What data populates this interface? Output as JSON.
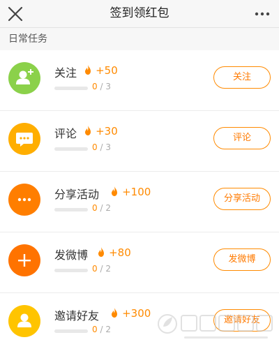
{
  "header": {
    "title": "签到领红包",
    "close_icon": "close-icon",
    "more_icon": "more-dots-icon"
  },
  "section": {
    "title": "日常任务"
  },
  "colors": {
    "accent": "#ff8a00",
    "follow_icon_bg": "#8bd14a",
    "comment_icon_bg": "#ffae00",
    "share_icon_bg": "#ff7e00",
    "post_icon_bg": "#ff7300",
    "invite_icon_bg": "#ffc400"
  },
  "tasks": [
    {
      "name": "关注",
      "reward": "+50",
      "progress_done": "0",
      "progress_total": "/ 3",
      "progress_fraction": 0,
      "button_label": "关注",
      "icon": "add-user-icon"
    },
    {
      "name": "评论",
      "reward": "+30",
      "progress_done": "0",
      "progress_total": "/ 3",
      "progress_fraction": 0,
      "button_label": "评论",
      "icon": "comment-icon"
    },
    {
      "name": "分享活动",
      "reward": "+100",
      "progress_done": "0",
      "progress_total": "/ 2",
      "progress_fraction": 0,
      "button_label": "分享活动",
      "icon": "share-dots-icon"
    },
    {
      "name": "发微博",
      "reward": "+80",
      "progress_done": "0",
      "progress_total": "/ 2",
      "progress_fraction": 0,
      "button_label": "发微博",
      "icon": "plus-icon"
    },
    {
      "name": "邀请好友",
      "reward": "+300",
      "progress_done": "0",
      "progress_total": "/ 2",
      "progress_fraction": 0,
      "button_label": "邀请好友",
      "icon": "invite-user-icon"
    }
  ],
  "watermark": {
    "text": "绿茶软件园",
    "url": "www.33LC.com"
  }
}
